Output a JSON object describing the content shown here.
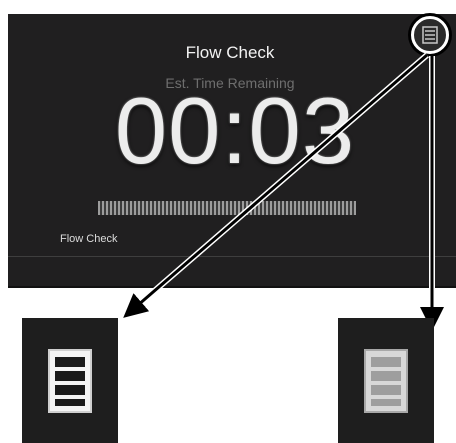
{
  "screen": {
    "title": "Flow Check",
    "subtitle": "Est. Time Remaining",
    "timer": "00:03",
    "status_label": "Flow Check",
    "progress": 1.0
  },
  "icons": {
    "menu": "list-menu-icon",
    "zoom_normal": "list-menu-icon-normal",
    "zoom_pressed": "list-menu-icon-pressed"
  },
  "colors": {
    "screen_background": "#201f20",
    "text_primary": "#f2f2f2",
    "text_secondary": "#6e6e6e",
    "callout_line": "#000000"
  }
}
